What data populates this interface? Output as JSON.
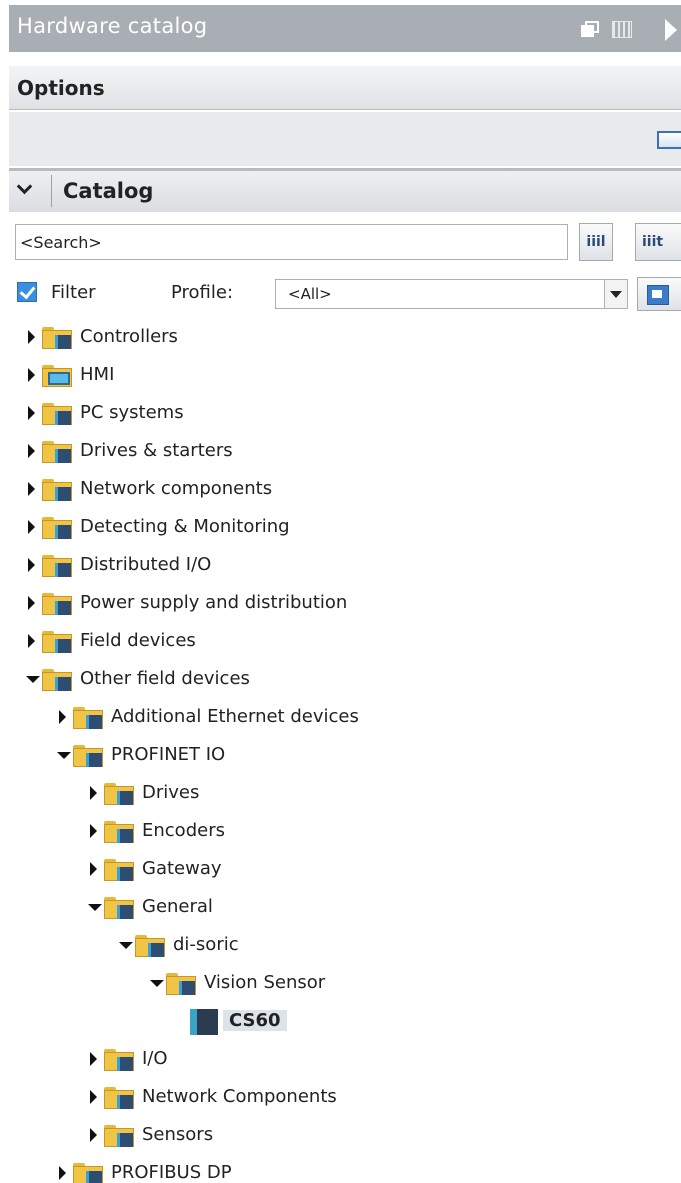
{
  "panel": {
    "title": "Hardware catalog",
    "icons": [
      "restore-icon",
      "grid-icon",
      "expand-right-icon"
    ]
  },
  "options": {
    "label": "Options"
  },
  "catalog": {
    "label": "Catalog"
  },
  "search": {
    "value": "<Search>",
    "btn_down": "iiil",
    "btn_up": "iiit"
  },
  "filter": {
    "checked": true,
    "label": "Filter",
    "profile_label": "Profile:",
    "profile_value": "<All>"
  },
  "tree": {
    "items": [
      {
        "label": "Controllers",
        "level": 0,
        "state": "collapsed",
        "icon": "folder-icon"
      },
      {
        "label": "HMI",
        "level": 0,
        "state": "collapsed",
        "icon": "folder-hmi-icon"
      },
      {
        "label": "PC systems",
        "level": 0,
        "state": "collapsed",
        "icon": "folder-icon"
      },
      {
        "label": "Drives & starters",
        "level": 0,
        "state": "collapsed",
        "icon": "folder-icon"
      },
      {
        "label": "Network components",
        "level": 0,
        "state": "collapsed",
        "icon": "folder-icon"
      },
      {
        "label": "Detecting & Monitoring",
        "level": 0,
        "state": "collapsed",
        "icon": "folder-icon"
      },
      {
        "label": "Distributed I/O",
        "level": 0,
        "state": "collapsed",
        "icon": "folder-icon"
      },
      {
        "label": "Power supply and distribution",
        "level": 0,
        "state": "collapsed",
        "icon": "folder-icon"
      },
      {
        "label": "Field devices",
        "level": 0,
        "state": "collapsed",
        "icon": "folder-icon"
      },
      {
        "label": "Other field devices",
        "level": 0,
        "state": "expanded",
        "icon": "folder-icon"
      },
      {
        "label": "Additional Ethernet devices",
        "level": 1,
        "state": "collapsed",
        "icon": "folder-icon"
      },
      {
        "label": "PROFINET IO",
        "level": 1,
        "state": "expanded",
        "icon": "folder-icon"
      },
      {
        "label": "Drives",
        "level": 2,
        "state": "collapsed",
        "icon": "folder-icon"
      },
      {
        "label": "Encoders",
        "level": 2,
        "state": "collapsed",
        "icon": "folder-icon"
      },
      {
        "label": "Gateway",
        "level": 2,
        "state": "collapsed",
        "icon": "folder-icon"
      },
      {
        "label": "General",
        "level": 2,
        "state": "expanded",
        "icon": "folder-icon"
      },
      {
        "label": "di-soric",
        "level": 3,
        "state": "expanded",
        "icon": "folder-icon"
      },
      {
        "label": "Vision Sensor",
        "level": 4,
        "state": "expanded",
        "icon": "folder-icon"
      },
      {
        "label": "CS60",
        "level": 5,
        "state": "leaf",
        "icon": "device-icon",
        "selected": true
      },
      {
        "label": "I/O",
        "level": 2,
        "state": "collapsed",
        "icon": "folder-icon"
      },
      {
        "label": "Network Components",
        "level": 2,
        "state": "collapsed",
        "icon": "folder-icon"
      },
      {
        "label": "Sensors",
        "level": 2,
        "state": "collapsed",
        "icon": "folder-icon"
      },
      {
        "label": "PROFIBUS DP",
        "level": 1,
        "state": "collapsed",
        "icon": "folder-icon"
      }
    ]
  }
}
